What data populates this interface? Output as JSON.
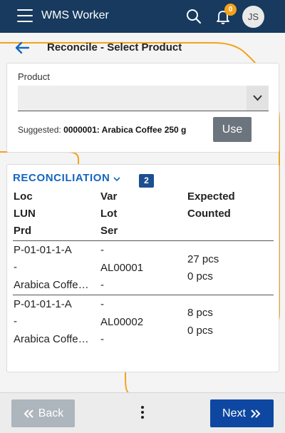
{
  "topbar": {
    "app_title": "WMS Worker",
    "notifications_count": "0",
    "avatar_initials": "JS",
    "icons": [
      "menu-icon",
      "search-icon",
      "bell-icon"
    ]
  },
  "page": {
    "title": "Reconcile - Select Product"
  },
  "product": {
    "label": "Product",
    "value": "",
    "suggested_label": "Suggested:",
    "suggested_value": "0000001: Arabica Coffee 250 g",
    "use_label": "Use"
  },
  "reconciliation": {
    "title": "RECONCILIATION",
    "count": "2",
    "columns": {
      "col1": [
        "Loc",
        "LUN",
        "Prd"
      ],
      "col2": [
        "Var",
        "Lot",
        "Ser"
      ],
      "col3": [
        "Expected",
        "Counted"
      ]
    },
    "rows": [
      {
        "loc": "P-01-01-1-A",
        "lun": "-",
        "prd": "Arabica Coffe…",
        "var": "-",
        "lot": "AL00001",
        "ser": "-",
        "expected": "27 pcs",
        "counted": "0 pcs"
      },
      {
        "loc": "P-01-01-1-A",
        "lun": "-",
        "prd": "Arabica Coffe…",
        "var": "-",
        "lot": "AL00002",
        "ser": "-",
        "expected": "8 pcs",
        "counted": "0 pcs"
      }
    ]
  },
  "footer": {
    "back_label": "Back",
    "next_label": "Next"
  },
  "colors": {
    "topbar": "#173a5e",
    "accent": "#1565c0",
    "badge": "#f2a31c",
    "next_button": "#0d47a1",
    "back_button": "#adb5bd",
    "use_button": "#6c757d",
    "decoration": "#f2a31c"
  }
}
